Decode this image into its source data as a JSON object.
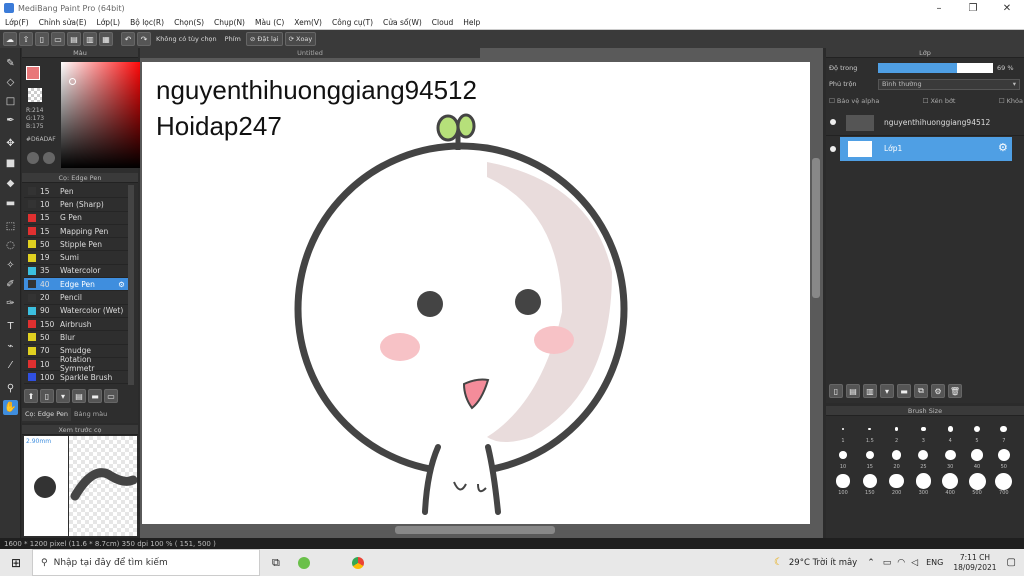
{
  "window": {
    "title": "MediBang Paint Pro (64bit)",
    "minimize": "–",
    "restore": "❐",
    "close": "✕"
  },
  "menu": [
    "Lớp(F)",
    "Chỉnh sửa(E)",
    "Lớp(L)",
    "Bộ lọc(R)",
    "Chọn(S)",
    "Chụp(N)",
    "Màu (C)",
    "Xem(V)",
    "Công cụ(T)",
    "Cửa sổ(W)",
    "Cloud",
    "Help"
  ],
  "toolbar": {
    "no_selection_label": "Không có tùy chọn",
    "key_label": "Phím",
    "reset_label": "Đặt lại",
    "rotate_label": "Xoay"
  },
  "color_panel": {
    "title": "Màu",
    "r": "R:214",
    "g": "G:173",
    "b": "B:175",
    "hex": "#D6ADAF",
    "fg": "#e8787a",
    "bg": "#ffffff"
  },
  "brush_panel": {
    "title": "Cọ: Edge Pen",
    "tab_brush": "Cọ: Edge Pen",
    "tab_palette": "Bảng màu",
    "brushes": [
      {
        "size": "15",
        "name": "Pen",
        "color": "#333"
      },
      {
        "size": "10",
        "name": "Pen (Sharp)",
        "color": "#333"
      },
      {
        "size": "15",
        "name": "G Pen",
        "color": "#e03030"
      },
      {
        "size": "15",
        "name": "Mapping Pen",
        "color": "#e03030"
      },
      {
        "size": "50",
        "name": "Stipple Pen",
        "color": "#e0d020"
      },
      {
        "size": "19",
        "name": "Sumi",
        "color": "#e0d020"
      },
      {
        "size": "35",
        "name": "Watercolor",
        "color": "#3cc0e0"
      },
      {
        "size": "40",
        "name": "Edge Pen",
        "color": "#333",
        "selected": true
      },
      {
        "size": "20",
        "name": "Pencil",
        "color": "#333"
      },
      {
        "size": "90",
        "name": "Watercolor (Wet)",
        "color": "#3cc0e0"
      },
      {
        "size": "150",
        "name": "Airbrush",
        "color": "#e03030"
      },
      {
        "size": "50",
        "name": "Blur",
        "color": "#e0d020"
      },
      {
        "size": "70",
        "name": "Smudge",
        "color": "#e0d020"
      },
      {
        "size": "10",
        "name": "Rotation Symmetr",
        "color": "#e03030"
      },
      {
        "size": "100",
        "name": "Sparkle Brush",
        "color": "#3050e0"
      }
    ]
  },
  "preview_panel": {
    "title": "Xem trước cọ",
    "size": "2.90mm"
  },
  "document": {
    "tab_title": "Untitled",
    "text_line1": "nguyenthihuonggiang94512",
    "text_line2": "Hoidap247"
  },
  "layer_panel": {
    "title": "Lớp",
    "opacity_label": "Độ trong",
    "opacity_value": "69 %",
    "opacity_fraction": 0.69,
    "blend_label": "Phủ trộn",
    "blend_value": "Bình thường",
    "protect_alpha": "Bảo vệ alpha",
    "clipping": "Xén bớt",
    "lock": "Khóa",
    "layers": [
      {
        "name": "nguyenthihuonggiang94512",
        "selected": false
      },
      {
        "name": "Lớp1",
        "selected": true
      }
    ]
  },
  "brush_size": {
    "title": "Brush Size",
    "sizes": [
      "1",
      "1.5",
      "2",
      "3",
      "4",
      "5",
      "7",
      "10",
      "15",
      "20",
      "25",
      "30",
      "40",
      "50",
      "100",
      "150",
      "200",
      "300",
      "400",
      "500",
      "700"
    ]
  },
  "statusbar": {
    "text": "1600 * 1200 pixel   (11.6 * 8.7cm)   350 dpi   100 %   ( 151, 500 )"
  },
  "taskbar": {
    "search_placeholder": "Nhập tại đây để tìm kiếm",
    "weather": "29°C  Trời ít mây",
    "lang": "ENG",
    "time": "7:11 CH",
    "date": "18/09/2021"
  }
}
